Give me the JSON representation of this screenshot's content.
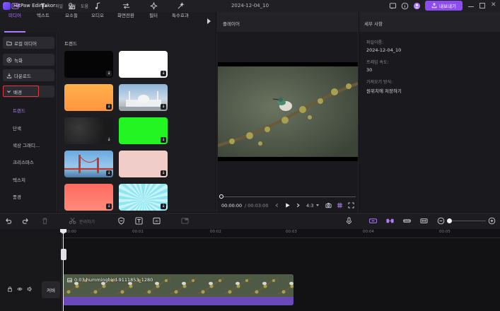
{
  "app": {
    "name": "HitPaw Edimakor",
    "project_title": "2024-12-04_10",
    "menu": [
      "파일",
      "설정",
      "도움"
    ],
    "export_label": "내보내기",
    "accent": "#8c4cf0"
  },
  "toolbar": {
    "tabs": [
      {
        "label": "미디어",
        "icon": "media-icon",
        "active": true
      },
      {
        "label": "텍스트",
        "icon": "text-icon"
      },
      {
        "label": "요소들",
        "icon": "elements-icon"
      },
      {
        "label": "오디오",
        "icon": "music-icon"
      },
      {
        "label": "화면전환",
        "icon": "transition-icon"
      },
      {
        "label": "필터",
        "icon": "filter-icon"
      },
      {
        "label": "특수효과",
        "icon": "effects-icon"
      }
    ]
  },
  "sidebar": {
    "items": [
      {
        "label": "로컬 미디어",
        "icon": "folder-icon"
      },
      {
        "label": "녹화",
        "icon": "record-icon"
      },
      {
        "label": "다운로드",
        "icon": "download-icon"
      },
      {
        "label": "배경",
        "icon": "chevron-down-icon"
      }
    ],
    "subitems": [
      "트렌드",
      "단색",
      "색상 그래디...",
      "크리스마스",
      "텍스처",
      "풍경"
    ]
  },
  "grid": {
    "title": "트렌드"
  },
  "player": {
    "title": "플레이어",
    "time_current": "00:00:00",
    "time_total": "/ 00:03:00",
    "ratio": "4:3"
  },
  "detail": {
    "title": "세부 사항",
    "fields": [
      {
        "label": "파일이름:",
        "value": "2024-12-04_10"
      },
      {
        "label": "프레임 속도:",
        "value": "30"
      },
      {
        "label": "가져오기 방식:",
        "value": "원위치에 저장하기"
      }
    ]
  },
  "timeline": {
    "split_label": "분리하기",
    "ticks": [
      "00:00",
      "00:01",
      "00:02",
      "00:03",
      "00:04",
      "00:05"
    ],
    "clip_label": "0:03 hummingbird-9111853_1280",
    "cover_label": "커버"
  }
}
